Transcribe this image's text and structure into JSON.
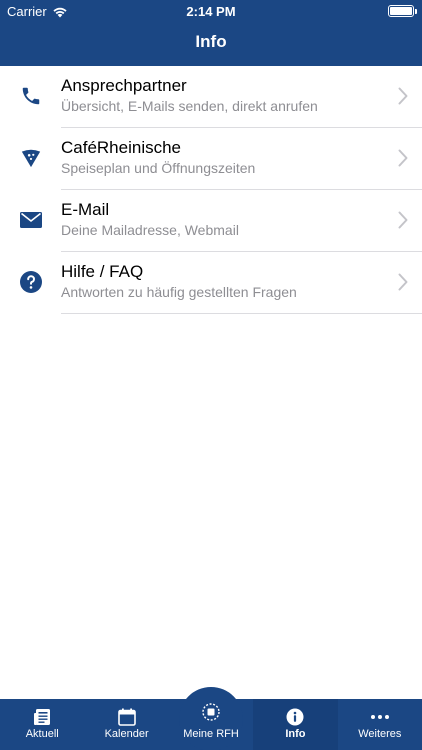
{
  "status": {
    "carrier": "Carrier",
    "time": "2:14 PM"
  },
  "nav": {
    "title": "Info"
  },
  "items": [
    {
      "title": "Ansprechpartner",
      "subtitle": "Übersicht, E-Mails senden, direkt anrufen",
      "icon": "phone-icon"
    },
    {
      "title": "CaféRheinische",
      "subtitle": "Speiseplan und Öffnungszeiten",
      "icon": "pizza-slice-icon"
    },
    {
      "title": "E-Mail",
      "subtitle": "Deine Mailadresse, Webmail",
      "icon": "envelope-icon"
    },
    {
      "title": "Hilfe / FAQ",
      "subtitle": "Antworten zu häufig gestellten Fragen",
      "icon": "question-icon"
    }
  ],
  "tabs": [
    {
      "label": "Aktuell",
      "icon": "newspaper-icon"
    },
    {
      "label": "Kalender",
      "icon": "calendar-icon"
    },
    {
      "label": "Meine RFH",
      "icon": "rfh-icon"
    },
    {
      "label": "Info",
      "icon": "info-icon",
      "active": true
    },
    {
      "label": "Weiteres",
      "icon": "more-icon"
    }
  ],
  "colors": {
    "brand": "#1b4784",
    "subtitle": "#8e8e93",
    "separator": "#dcdce0"
  }
}
